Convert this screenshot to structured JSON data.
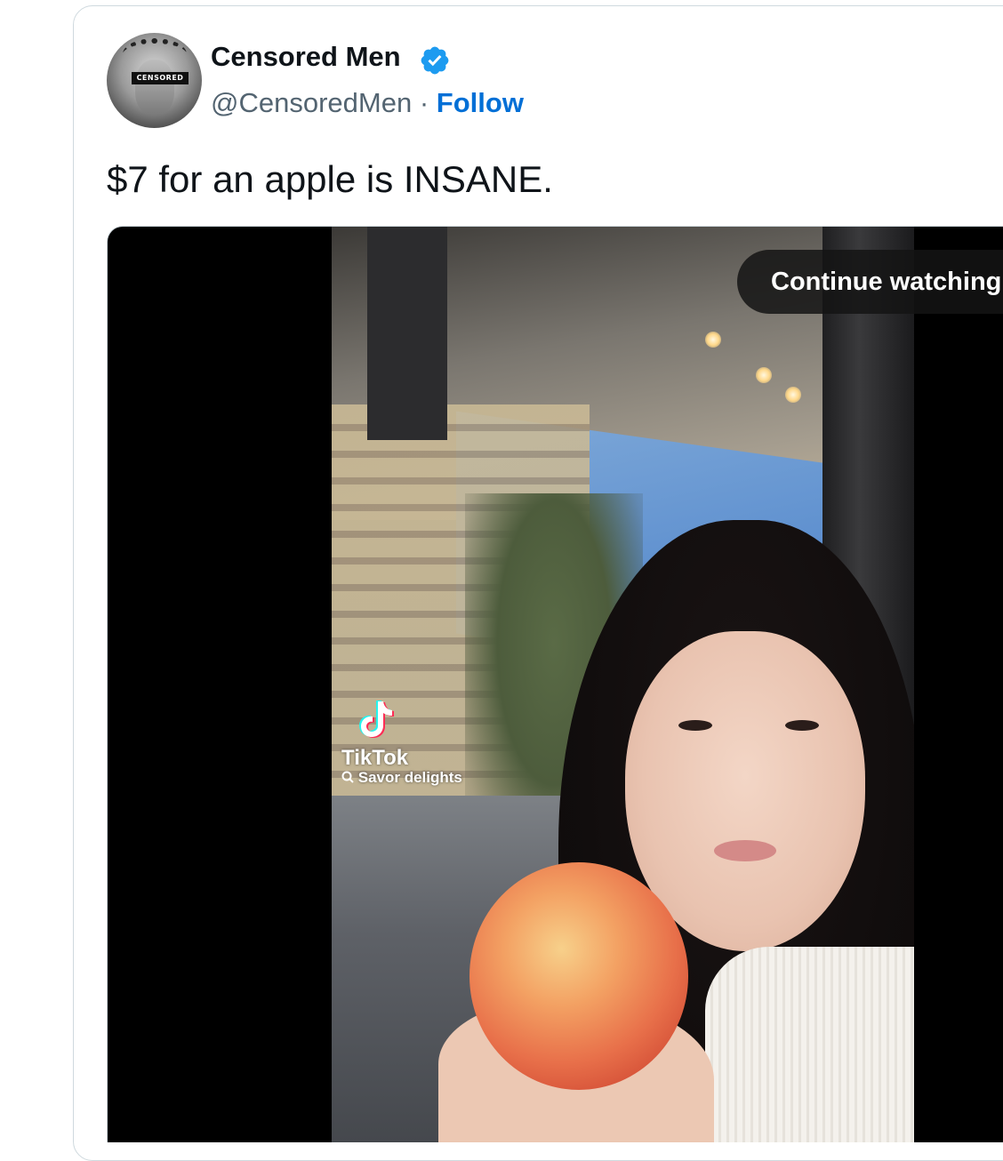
{
  "tweet": {
    "author": {
      "display_name": "Censored Men",
      "handle": "@CensoredMen",
      "separator": "·",
      "verified": true,
      "avatar_label": "CENSORED"
    },
    "follow_label": "Follow",
    "text": "$7 for an apple is INSANE."
  },
  "media": {
    "continue_label": "Continue watching",
    "watermark": {
      "brand": "TikTok",
      "search_text": "Savor delights",
      "search_icon": "search-icon"
    }
  },
  "colors": {
    "link": "#006fd6",
    "verified": "#1d9bf0",
    "text_primary": "#0f1419",
    "text_secondary": "#536471",
    "border": "#cfd9de"
  }
}
